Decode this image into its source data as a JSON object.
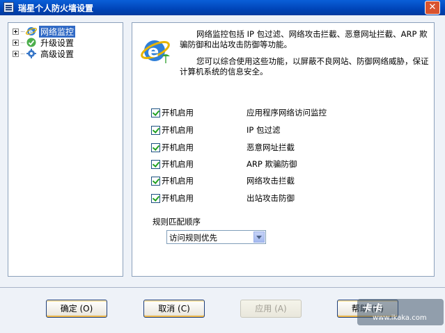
{
  "window": {
    "title": "瑞星个人防火墙设置",
    "close_symbol": "✕"
  },
  "tree": {
    "items": [
      {
        "label": "网络监控",
        "icon": "ie-globe-icon",
        "selected": true
      },
      {
        "label": "升级设置",
        "icon": "update-icon",
        "selected": false
      },
      {
        "label": "高级设置",
        "icon": "gear-icon",
        "selected": false
      }
    ]
  },
  "content": {
    "description_1": "网络监控包括 IP 包过滤、网络攻击拦截、恶意网址拦截、ARP 欺骗防御和出站攻击防御等功能。",
    "description_2": "您可以综合使用这些功能，以屏蔽不良网站、防御网络威胁，保证计算机系统的信息安全。",
    "features": [
      {
        "checkbox_label": "开机启用",
        "checked": true,
        "name": "应用程序网络访问监控"
      },
      {
        "checkbox_label": "开机启用",
        "checked": true,
        "name": "IP 包过滤"
      },
      {
        "checkbox_label": "开机启用",
        "checked": true,
        "name": "恶意网址拦截"
      },
      {
        "checkbox_label": "开机启用",
        "checked": true,
        "name": "ARP 欺骗防御"
      },
      {
        "checkbox_label": "开机启用",
        "checked": true,
        "name": "网络攻击拦截"
      },
      {
        "checkbox_label": "开机启用",
        "checked": true,
        "name": "出站攻击防御"
      }
    ],
    "rule_order_label": "规则匹配顺序",
    "rule_order_value": "访问规则优先"
  },
  "buttons": {
    "ok": "确定 (O)",
    "cancel": "取消 (C)",
    "apply": "应用 (A)",
    "help": "帮助 (H)"
  },
  "watermark": {
    "logo": "卡卡",
    "url": "www.ikaka.com"
  }
}
